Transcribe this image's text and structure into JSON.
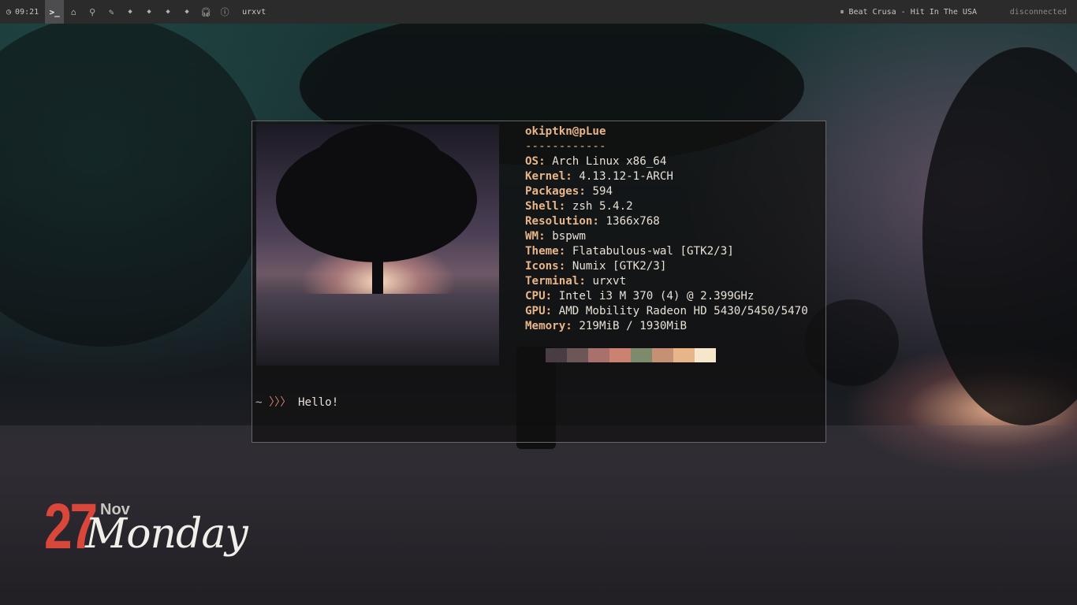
{
  "bar": {
    "clock": "09:21",
    "clock_icon": "clock-icon",
    "terminal_tab_icon": "terminal-icon",
    "workspace_icons": [
      "home-icon",
      "search-icon",
      "pencil-icon",
      "diamond-icon",
      "diamond-icon",
      "diamond-icon",
      "diamond-icon",
      "headphones-icon",
      "info-icon"
    ],
    "window_title": "urxvt",
    "music_icon": "pause-icon",
    "music": "Beat Crusa - Hit In The USA",
    "network": "disconnected"
  },
  "terminal": {
    "user_host": "okiptkn@pLue",
    "separator": "------------",
    "fields": [
      {
        "key": "OS",
        "value": "Arch Linux x86_64"
      },
      {
        "key": "Kernel",
        "value": "4.13.12-1-ARCH"
      },
      {
        "key": "Packages",
        "value": "594"
      },
      {
        "key": "Shell",
        "value": "zsh 5.4.2"
      },
      {
        "key": "Resolution",
        "value": "1366x768"
      },
      {
        "key": "WM",
        "value": "bspwm"
      },
      {
        "key": "Theme",
        "value": "Flatabulous-wal [GTK2/3]"
      },
      {
        "key": "Icons",
        "value": "Numix [GTK2/3]"
      },
      {
        "key": "Terminal",
        "value": "urxvt"
      },
      {
        "key": "CPU",
        "value": "Intel i3 M 370 (4) @ 2.399GHz"
      },
      {
        "key": "GPU",
        "value": "AMD Mobility Radeon HD 5430/5450/5470"
      },
      {
        "key": "Memory",
        "value": "219MiB / 1930MiB"
      }
    ],
    "palette": [
      "#473d42",
      "#6d5656",
      "#a8716c",
      "#cc8271",
      "#7d8a6c",
      "#c69075",
      "#e8b589",
      "#f6e6cc"
    ],
    "prompt_tilde": "~",
    "prompt_arrows": "〉〉〉",
    "prompt_text": "Hello!"
  },
  "date": {
    "day": "27",
    "month": "Nov",
    "weekday": "Monday"
  }
}
